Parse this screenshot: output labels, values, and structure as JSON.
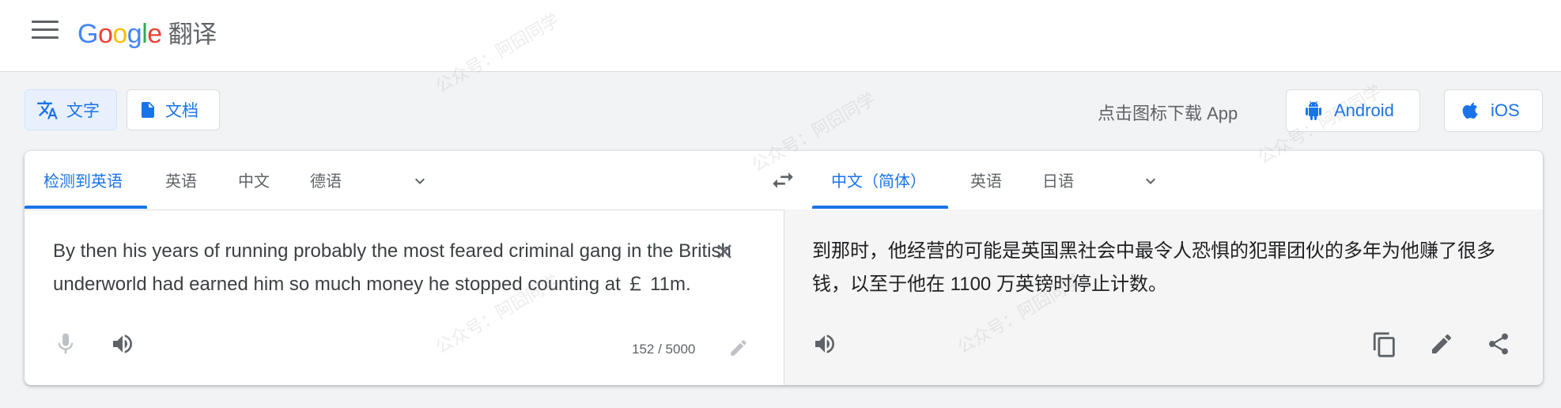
{
  "header": {
    "logo_letters": [
      "G",
      "o",
      "o",
      "g",
      "l",
      "e"
    ],
    "product": "翻译",
    "menu_icon": "hamburger-menu-icon"
  },
  "modes": {
    "text_label": "文字",
    "doc_label": "文档"
  },
  "download": {
    "prompt": "点击图标下载 App",
    "android_label": "Android",
    "ios_label": "iOS"
  },
  "source": {
    "tabs": [
      "检测到英语",
      "英语",
      "中文",
      "德语"
    ],
    "active_tab": 0,
    "text": "By then his years of running probably the most feared criminal gang in the British underworld had earned him so much money he stopped counting at ￡ 11m.",
    "char_count": "152 / 5000"
  },
  "target": {
    "tabs": [
      "中文（简体）",
      "英语",
      "日语"
    ],
    "active_tab": 0,
    "text": "到那时，他经营的可能是英国黑社会中最令人恐惧的犯罪团伙的多年为他赚了很多钱，以至于他在 1100 万英镑时停止计数。"
  },
  "watermark": "公众号：阿囧同学",
  "colors": {
    "accent": "#1a73e8",
    "icon_gray": "#5f6368",
    "page_bg": "#f1f3f4"
  }
}
